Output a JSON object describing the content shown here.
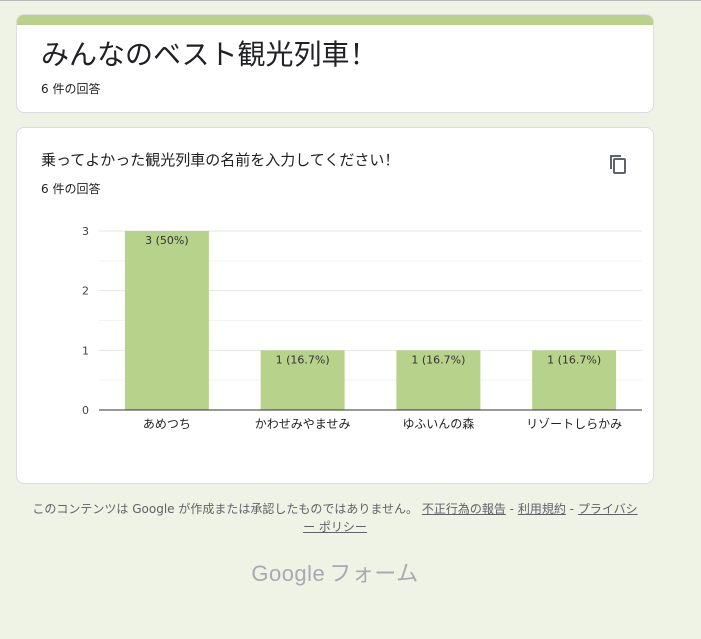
{
  "form": {
    "title": "みんなのベスト観光列車！",
    "response_count": "6 件の回答"
  },
  "question": {
    "title": "乗ってよかった観光列車の名前を入力してください！",
    "response_count": "6 件の回答",
    "copy_icon": "copy-icon"
  },
  "chart_data": {
    "type": "bar",
    "categories": [
      "あめつち",
      "かわせみやませみ",
      "ゆふいんの森",
      "リゾートしらかみ"
    ],
    "values": [
      3,
      1,
      1,
      1
    ],
    "data_labels": [
      "3 (50%)",
      "1 (16.7%)",
      "1 (16.7%)",
      "1 (16.7%)"
    ],
    "y_ticks": [
      "0",
      "1",
      "2",
      "3"
    ],
    "ylim": [
      0,
      3
    ],
    "grid": true,
    "bar_color": "#b7d28b"
  },
  "footer": {
    "disclaimer": "このコンテンツは Google が作成または承認したものではありません。",
    "report_link": "不正行為の報告",
    "separator1": " - ",
    "terms_link": "利用規約",
    "separator2": " - ",
    "privacy_link": "プライバシー ポリシー"
  },
  "logo": {
    "google": "Google",
    "forms": "フォーム"
  },
  "colors": {
    "background": "#eef3e6",
    "accent": "#b9d18a",
    "bar": "#b7d28b"
  }
}
